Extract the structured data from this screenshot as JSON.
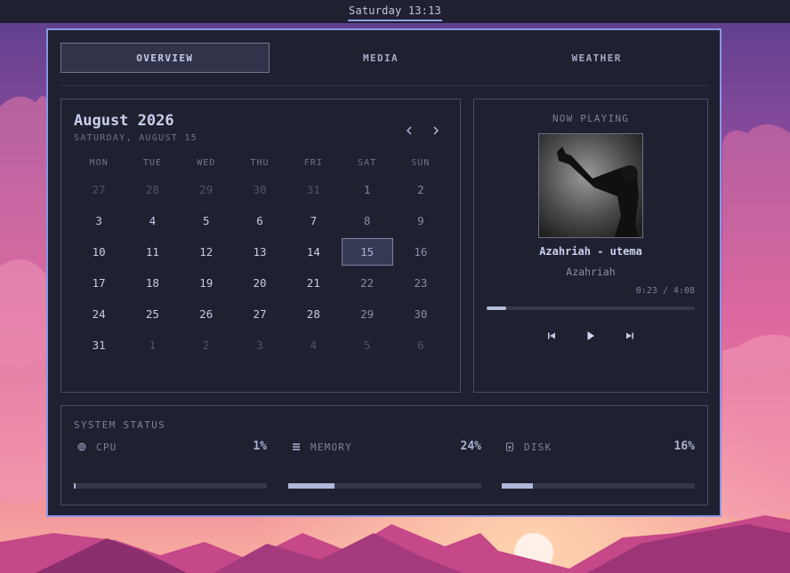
{
  "topbar": {
    "clock": "Saturday 13:13"
  },
  "tabs": [
    {
      "label": "OVERVIEW",
      "active": true
    },
    {
      "label": "MEDIA",
      "active": false
    },
    {
      "label": "WEATHER",
      "active": false
    }
  ],
  "calendar": {
    "month_title": "August 2026",
    "date_subtitle": "SATURDAY, AUGUST 15",
    "weekdays": [
      "MON",
      "TUE",
      "WED",
      "THU",
      "FRI",
      "SAT",
      "SUN"
    ],
    "today": 15,
    "weeks": [
      [
        {
          "d": "27",
          "o": true
        },
        {
          "d": "28",
          "o": true
        },
        {
          "d": "29",
          "o": true
        },
        {
          "d": "30",
          "o": true
        },
        {
          "d": "31",
          "o": true
        },
        {
          "d": "1"
        },
        {
          "d": "2"
        }
      ],
      [
        {
          "d": "3"
        },
        {
          "d": "4"
        },
        {
          "d": "5"
        },
        {
          "d": "6"
        },
        {
          "d": "7"
        },
        {
          "d": "8"
        },
        {
          "d": "9"
        }
      ],
      [
        {
          "d": "10"
        },
        {
          "d": "11"
        },
        {
          "d": "12"
        },
        {
          "d": "13"
        },
        {
          "d": "14"
        },
        {
          "d": "15"
        },
        {
          "d": "16"
        }
      ],
      [
        {
          "d": "17"
        },
        {
          "d": "18"
        },
        {
          "d": "19"
        },
        {
          "d": "20"
        },
        {
          "d": "21"
        },
        {
          "d": "22"
        },
        {
          "d": "23"
        }
      ],
      [
        {
          "d": "24"
        },
        {
          "d": "25"
        },
        {
          "d": "26"
        },
        {
          "d": "27"
        },
        {
          "d": "28"
        },
        {
          "d": "29"
        },
        {
          "d": "30"
        }
      ],
      [
        {
          "d": "31"
        },
        {
          "d": "1",
          "o": true
        },
        {
          "d": "2",
          "o": true
        },
        {
          "d": "3",
          "o": true
        },
        {
          "d": "4",
          "o": true
        },
        {
          "d": "5",
          "o": true
        },
        {
          "d": "6",
          "o": true
        }
      ]
    ],
    "prev_icon": "chevron-left-icon",
    "next_icon": "chevron-right-icon"
  },
  "media": {
    "label": "NOW PLAYING",
    "track": "Azahriah - utema",
    "artist": "Azahriah",
    "time": "0:23 / 4:08",
    "progress": 0.093,
    "controls": [
      "skip-previous-icon",
      "play-icon",
      "skip-next-icon"
    ]
  },
  "system": {
    "title": "SYSTEM STATUS",
    "metrics": [
      {
        "label": "CPU",
        "value": "1%",
        "percent": 1,
        "icon": "cpu-icon"
      },
      {
        "label": "MEMORY",
        "value": "24%",
        "percent": 24,
        "icon": "memory-icon"
      },
      {
        "label": "DISK",
        "value": "16%",
        "percent": 16,
        "icon": "disk-icon"
      }
    ]
  },
  "colors": {
    "accent": "#8796e6",
    "panel": "#1f2130",
    "border": "#4a4d64",
    "text": "#c3c9e8",
    "muted": "#7d829e"
  }
}
